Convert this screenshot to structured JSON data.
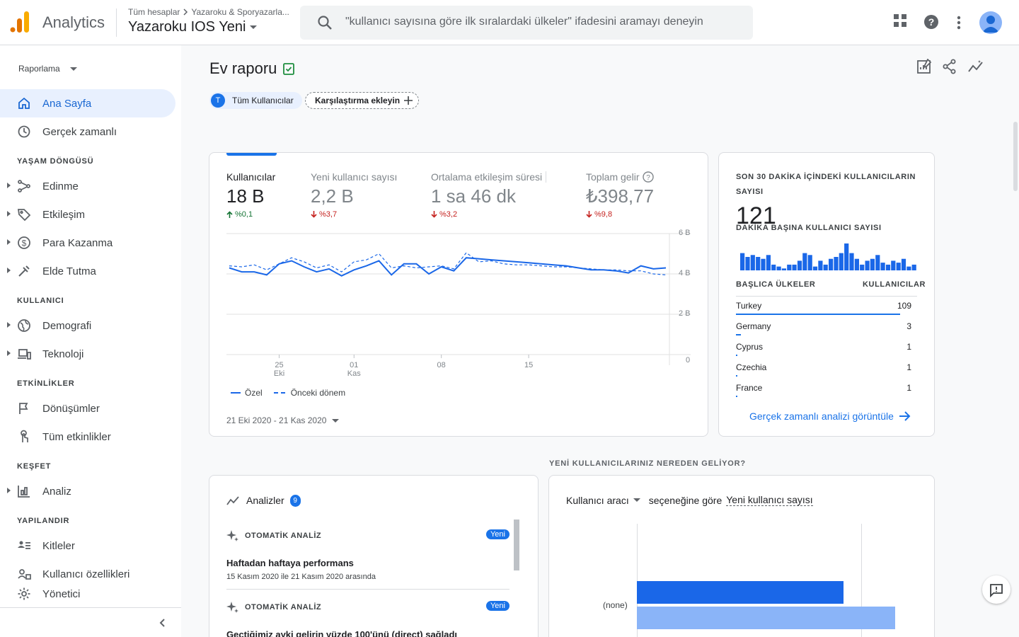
{
  "header": {
    "app_name": "Analytics",
    "breadcrumb": [
      "Tüm hesaplar",
      "Yazaroku & Sporyazarla..."
    ],
    "property_name": "Yazaroku IOS Yeni",
    "search_placeholder": "\"kullanıcı sayısına göre ilk sıralardaki ülkeler\" ifadesini aramayı deneyin"
  },
  "sidebar": {
    "selector": "Raporlama",
    "items": [
      {
        "label": "Ana Sayfa",
        "icon": "home-icon"
      },
      {
        "label": "Gerçek zamanlı",
        "icon": "clock-icon"
      },
      {
        "label": "Edinme",
        "icon": "acquisition-icon"
      },
      {
        "label": "Etkileşim",
        "icon": "tag-icon"
      },
      {
        "label": "Para Kazanma",
        "icon": "dollar-icon"
      },
      {
        "label": "Elde Tutma",
        "icon": "retention-icon"
      },
      {
        "label": "Demografi",
        "icon": "globe-icon"
      },
      {
        "label": "Teknoloji",
        "icon": "devices-icon"
      },
      {
        "label": "Dönüşümler",
        "icon": "flag-icon"
      },
      {
        "label": "Tüm etkinlikler",
        "icon": "touch-icon"
      },
      {
        "label": "Analiz",
        "icon": "analysis-icon"
      },
      {
        "label": "Kitleler",
        "icon": "audience-icon"
      },
      {
        "label": "Kullanıcı özellikleri",
        "icon": "user-properties-icon"
      },
      {
        "label": "Yönetici",
        "icon": "gear-icon"
      }
    ],
    "sections": [
      "YAŞAM DÖNGÜSÜ",
      "KULLANICI",
      "ETKİNLİKLER",
      "KEŞFET",
      "YAPILANDIR"
    ]
  },
  "page": {
    "title": "Ev raporu",
    "chip_all_users_initial": "T",
    "chip_all_users": "Tüm Kullanıcılar",
    "chip_add_comparison": "Karşılaştırma ekleyin"
  },
  "kpis": [
    {
      "label": "Kullanıcılar",
      "value": "18 B",
      "change": "%0,1",
      "direction": "up"
    },
    {
      "label": "Yeni kullanıcı sayısı",
      "value": "2,2 B",
      "change": "%3,7",
      "direction": "down"
    },
    {
      "label": "Ortalama etkileşim süresi",
      "value": "1 sa 46 dk",
      "change": "%3,2",
      "direction": "down"
    },
    {
      "label": "Toplam gelir",
      "value": "₺398,77",
      "change": "%9,8",
      "direction": "down"
    }
  ],
  "chart_data": {
    "type": "line",
    "y_ticks": [
      "6 B",
      "4 B",
      "2 B",
      "0"
    ],
    "ylim": [
      0,
      6000
    ],
    "x_ticks": [
      {
        "day": "25",
        "month": "Eki"
      },
      {
        "day": "01",
        "month": "Kas"
      },
      {
        "day": "08",
        "month": ""
      },
      {
        "day": "15",
        "month": ""
      }
    ],
    "series": [
      {
        "name": "Özel",
        "style": "solid",
        "values": [
          4300,
          4100,
          4100,
          3950,
          4500,
          4650,
          4350,
          4100,
          4250,
          3900,
          4200,
          4400,
          4650,
          3950,
          4500,
          4500,
          4000,
          4350,
          4150,
          4800,
          4750,
          4700,
          4650,
          4600,
          4550,
          4500,
          4450,
          4400,
          4300,
          4200,
          4200,
          4150,
          4050,
          4400,
          4250,
          4300
        ]
      },
      {
        "name": "Önceki dönem",
        "style": "dashed",
        "values": [
          4400,
          4350,
          4450,
          4200,
          4500,
          4800,
          4600,
          4300,
          4450,
          4100,
          4600,
          4700,
          5000,
          4300,
          4400,
          4300,
          4350,
          4400,
          4250,
          5050,
          4600,
          4650,
          4500,
          4450,
          4450,
          4400,
          4350,
          4350,
          4300,
          4250,
          4200,
          4200,
          4150,
          4150,
          4000,
          3950
        ]
      }
    ],
    "legend": [
      "Özel",
      "Önceki dönem"
    ]
  },
  "date_range": "21 Eki 2020 - 21 Kas 2020",
  "realtime": {
    "title": "SON 30 DAKİKA İÇİNDEKİ KULLANICILARIN SAYISI",
    "count": "121",
    "per_minute_label": "DAKİKA BAŞINA KULLANICI SAYISI",
    "per_minute_values": [
      9,
      7,
      8,
      7,
      6,
      8,
      3,
      2,
      1,
      3,
      3,
      5,
      9,
      8,
      2,
      5,
      3,
      6,
      7,
      9,
      14,
      9,
      6,
      3,
      5,
      6,
      8,
      4,
      3,
      5,
      4,
      6,
      2,
      3
    ],
    "countries_header": "BAŞLICA ÜLKELER",
    "users_header": "KULLANICILAR",
    "countries": [
      {
        "name": "Turkey",
        "users": "109",
        "share": 1.0
      },
      {
        "name": "Germany",
        "users": "3",
        "share": 0.03
      },
      {
        "name": "Cyprus",
        "users": "1",
        "share": 0.01
      },
      {
        "name": "Czechia",
        "users": "1",
        "share": 0.01
      },
      {
        "name": "France",
        "users": "1",
        "share": 0.01
      }
    ],
    "link": "Gerçek zamanlı analizi görüntüle"
  },
  "where_from_title": "YENİ KULLANICILARINIZ NEREDEN GELİYOR?",
  "insights": {
    "title": "Analizler",
    "count": "9",
    "items": [
      {
        "label": "OTOMATİK ANALİZ",
        "badge": "Yeni",
        "title": "Haftadan haftaya performans",
        "desc": "15 Kasım 2020 ile 21 Kasım 2020 arasında"
      },
      {
        "label": "OTOMATİK ANALİZ",
        "badge": "Yeni",
        "title": "Geçtiğimiz ayki gelirin yüzde 100'ünü (direct) sağladı",
        "desc": ""
      }
    ]
  },
  "source_chart": {
    "dimension": "Kullanıcı aracı",
    "by_text": "seçeneğine göre",
    "metric": "Yeni kullanıcı sayısı",
    "category": "(none)",
    "current_share": 0.8,
    "previous_share": 1.0,
    "colors": {
      "current": "#1a67e8",
      "previous": "#8ab4f8"
    }
  },
  "colors": {
    "accent": "#1a73e8",
    "up": "#137333",
    "down": "#c5221f"
  }
}
